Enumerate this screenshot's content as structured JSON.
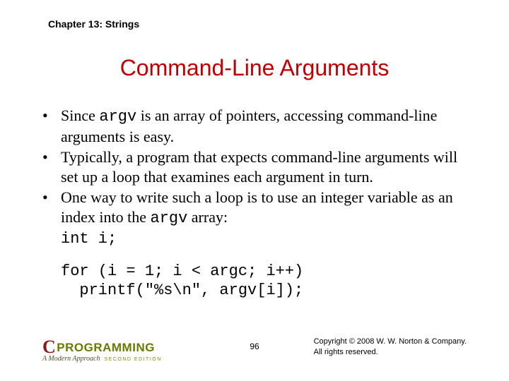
{
  "chapter_header": "Chapter 13: Strings",
  "title": "Command-Line Arguments",
  "bullets": [
    {
      "parts": [
        {
          "text": "Since ",
          "mono": false
        },
        {
          "text": "argv",
          "mono": true
        },
        {
          "text": " is an array of pointers, accessing command-line arguments is easy.",
          "mono": false
        }
      ]
    },
    {
      "parts": [
        {
          "text": "Typically, a program that expects command-line arguments will set up a loop that examines each argument in turn.",
          "mono": false
        }
      ]
    },
    {
      "parts": [
        {
          "text": "One way to write such a loop is to use an integer variable as an index into the ",
          "mono": false
        },
        {
          "text": "argv",
          "mono": true
        },
        {
          "text": " array:",
          "mono": false
        }
      ]
    }
  ],
  "code_prelude": "int i;",
  "code_block": "for (i = 1; i < argc; i++)\n  printf(\"%s\\n\", argv[i]);",
  "brand": {
    "c": "C",
    "prog": "PROGRAMMING",
    "sub": "A Modern Approach",
    "edition": "SECOND EDITION"
  },
  "page_num": "96",
  "copyright_line1": "Copyright © 2008 W. W. Norton & Company.",
  "copyright_line2": "All rights reserved."
}
